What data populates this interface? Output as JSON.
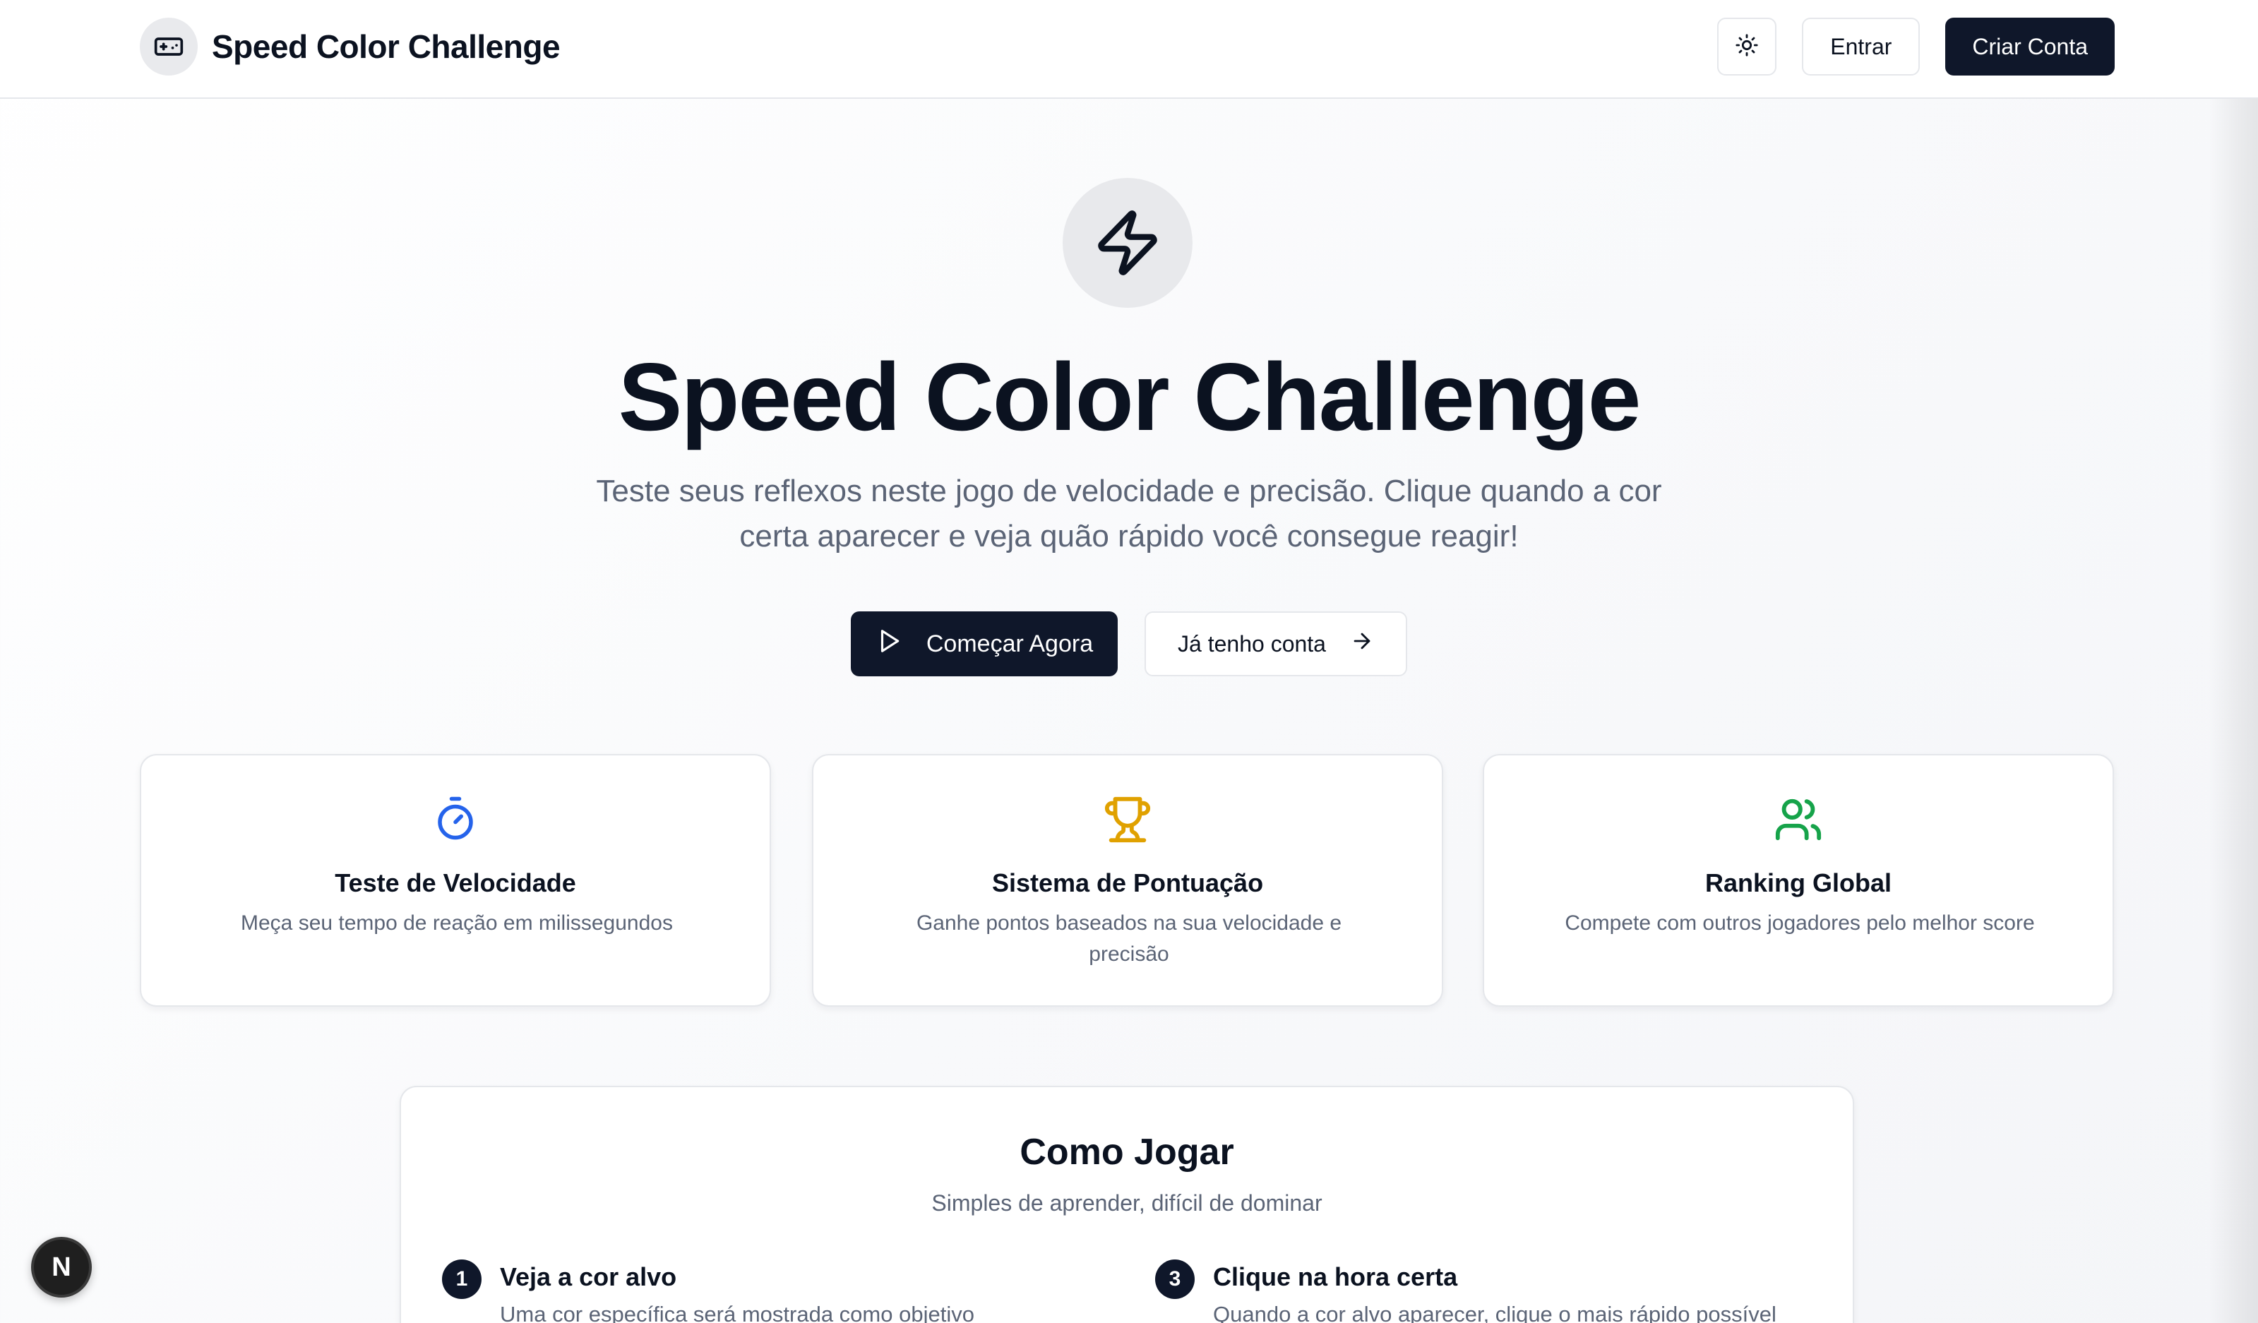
{
  "navbar": {
    "brand_title": "Speed Color Challenge",
    "brand_icon": "gamepad-icon",
    "theme_icon": "sun-icon",
    "login_label": "Entrar",
    "signup_label": "Criar Conta"
  },
  "hero": {
    "icon": "lightning-icon",
    "title": "Speed Color Challenge",
    "subtitle": "Teste seus reflexos neste jogo de velocidade e precisão. Clique quando a cor certa aparecer e veja quão rápido você consegue reagir!",
    "primary_cta": "Começar Agora",
    "primary_cta_icon": "play-icon",
    "secondary_cta": "Já tenho conta",
    "secondary_cta_icon": "arrow-right-icon"
  },
  "features": [
    {
      "icon": "stopwatch-icon",
      "color": "#2563eb",
      "title": "Teste de Velocidade",
      "description": "Meça seu tempo de reação em milissegundos"
    },
    {
      "icon": "trophy-icon",
      "color": "#e0a100",
      "title": "Sistema de Pontuação",
      "description": "Ganhe pontos baseados na sua velocidade e precisão"
    },
    {
      "icon": "users-icon",
      "color": "#16a34a",
      "title": "Ranking Global",
      "description": "Compete com outros jogadores pelo melhor score"
    }
  ],
  "how_to_play": {
    "title": "Como Jogar",
    "subtitle": "Simples de aprender, difícil de dominar",
    "steps": [
      {
        "number": "1",
        "title": "Veja a cor alvo",
        "description": "Uma cor específica será mostrada como objetivo"
      },
      {
        "number": "3",
        "title": "Clique na hora certa",
        "description": "Quando a cor alvo aparecer, clique o mais rápido possível"
      }
    ]
  },
  "dev_badge": {
    "label": "N"
  },
  "colors": {
    "primary_dark": "#0f172a",
    "muted_text": "#5b6476",
    "border": "#e5e7eb"
  }
}
